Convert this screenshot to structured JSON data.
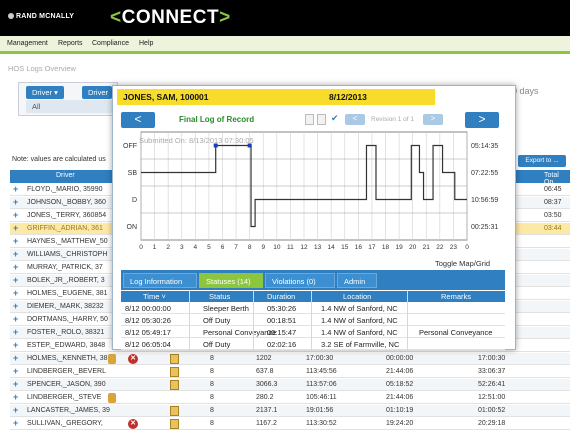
{
  "header": {
    "brand": "RAND MCNALLY",
    "app": "CONNECT"
  },
  "menu": [
    "Management",
    "Reports",
    "Compliance",
    "Help"
  ],
  "page_title": "HOS Logs Overview",
  "filters": {
    "driver1": "Driver",
    "driver2": "Driver",
    "all": "All",
    "days": "0 days"
  },
  "note": "Note: values are calculated us",
  "export_label": "Export to ...",
  "table": {
    "header": {
      "driver": "Driver",
      "total": "Total On"
    },
    "rows": [
      {
        "name": "FLOYD,_MARIO, 35990",
        "total": "06:45",
        "cells": []
      },
      {
        "name": "JOHNSON,_BOBBY, 360",
        "total": "08:37",
        "cells": []
      },
      {
        "name": "JONES,_TERRY, 360854",
        "total": "03:50",
        "cells": []
      },
      {
        "name": "GRIFFIN,_ADRIAN, 361",
        "total": "03:44",
        "cells": []
      },
      {
        "name": "HAYNES,_MATTHEW_50",
        "total": "",
        "cells": []
      },
      {
        "name": "WILLIAMS,_CHRISTOPH",
        "total": "",
        "cells": []
      },
      {
        "name": "MURRAY,_PATRICK, 37",
        "total": "",
        "cells": []
      },
      {
        "name": "BOLEK_JR_,ROBERT, 3",
        "total": "",
        "cells": []
      },
      {
        "name": "HOLMES,_EUGENE, 381",
        "total": "",
        "cells": []
      },
      {
        "name": "DIEMER,_MARK, 38232",
        "total": "",
        "cells": []
      },
      {
        "name": "DORTMANS,_HARRY, 50",
        "total": "",
        "cells": []
      },
      {
        "name": "FOSTER,_ROLO, 38321",
        "total": "",
        "cells": []
      },
      {
        "name": "ESTEP,_EDWARD, 3848",
        "total": "",
        "cells": []
      },
      {
        "name": "HOLMES,_KENNETH, 38",
        "total": "",
        "cells": [
          "8",
          "1202",
          "17:00:30",
          "00:00:00",
          "17:00:30"
        ]
      },
      {
        "name": "LINDBERGER,_BEVERL",
        "total": "",
        "cells": [
          "8",
          "637.8",
          "113:45:56",
          "21:44:06",
          "33:06:37"
        ]
      },
      {
        "name": "SPENCER,_JASON, 390",
        "total": "",
        "cells": [
          "8",
          "3066.3",
          "113:57:06",
          "05:18:52",
          "52:26:41"
        ]
      },
      {
        "name": "LINDBERGER,_STEVE",
        "total": "",
        "cells": [
          "8",
          "280.2",
          "105:46:11",
          "21:44:06",
          "12:51:00"
        ]
      },
      {
        "name": "LANCASTER,_JAMES, 39",
        "total": "",
        "cells": [
          "8",
          "2137.1",
          "19:01:56",
          "01:10:19",
          "01:00:52"
        ]
      },
      {
        "name": "SULLIVAN,_GREGORY,",
        "total": "",
        "cells": [
          "8",
          "1167.2",
          "113:30:52",
          "19:24:20",
          "20:29:18"
        ]
      }
    ]
  },
  "modal": {
    "driver": "JONES, SAM, 100001",
    "date": "8/12/2013",
    "log_title": "Final Log of Record",
    "revision": "Revision 1 of 1",
    "submitted": "Submitted On: 8/13/2013 07:30:05",
    "toggle": "Toggle Map/Grid",
    "prev": "<",
    "next": ">",
    "check": "✔",
    "small_prev": "<",
    "small_next": ">",
    "tabs": [
      "Log Information",
      "Statuses (14)",
      "Violations (0)",
      "Admin"
    ],
    "grid": {
      "headers": [
        "Time ˅",
        "Status",
        "Duration",
        "Location",
        "Remarks"
      ],
      "rows": [
        [
          "8/12 00:00:00",
          "Sleeper Berth",
          "05:30:26",
          "1.4 NW of Sanford, NC",
          ""
        ],
        [
          "8/12 05:30:26",
          "Off Duty",
          "00:18:51",
          "1.4 NW of Sanford, NC",
          ""
        ],
        [
          "8/12 05:49:17",
          "Personal Conveyance",
          "00:15:47",
          "1.4 NW of Sanford, NC",
          "Personal Conveyance"
        ],
        [
          "8/12 06:05:04",
          "Off Duty",
          "02:02:16",
          "3.2 SE of Farmville, NC",
          ""
        ]
      ]
    }
  },
  "chart_data": {
    "type": "line",
    "title": "",
    "categories_y": [
      "OFF",
      "SB",
      "D",
      "ON"
    ],
    "x_ticks": [
      "0",
      "1",
      "2",
      "3",
      "4",
      "5",
      "6",
      "7",
      "8",
      "9",
      "10",
      "11",
      "12",
      "13",
      "14",
      "15",
      "16",
      "17",
      "18",
      "19",
      "20",
      "21",
      "22",
      "23",
      "0"
    ],
    "right_totals": [
      "05:14:35",
      "07:22:55",
      "10:56:59",
      "00:25:31"
    ],
    "steps": [
      {
        "x": 0,
        "status": "SB"
      },
      {
        "x": 5.5,
        "status": "OFF"
      },
      {
        "x": 8.1,
        "status": "ON"
      },
      {
        "x": 8.4,
        "status": "D"
      },
      {
        "x": 16.6,
        "status": "OFF"
      },
      {
        "x": 17.3,
        "status": "D"
      },
      {
        "x": 19.9,
        "status": "OFF"
      },
      {
        "x": 20.5,
        "status": "SB"
      },
      {
        "x": 20.8,
        "status": "D"
      },
      {
        "x": 21.5,
        "status": "OFF"
      },
      {
        "x": 22.2,
        "status": "SB"
      },
      {
        "x": 23.1,
        "status": "D"
      }
    ],
    "markers_x": [
      5.5,
      8.0
    ],
    "line_color": "#333333",
    "marker_color": "#1a3fb8"
  }
}
